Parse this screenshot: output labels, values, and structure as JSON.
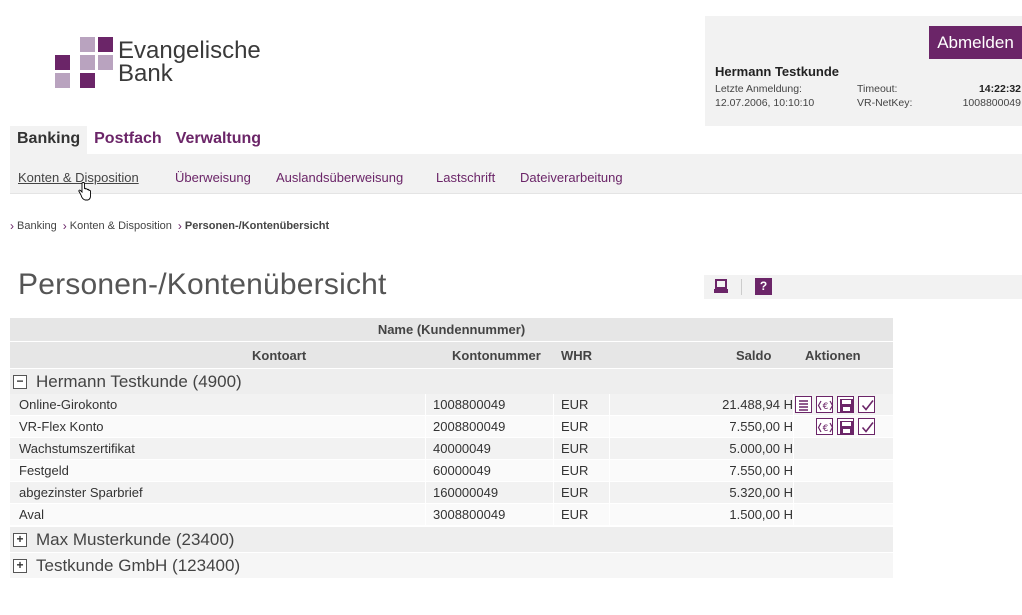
{
  "brand": {
    "name_line1": "Evangelische",
    "name_line2": "Bank",
    "colors": {
      "primary": "#6b2568",
      "light": "#b9a3bf"
    }
  },
  "user": {
    "logout_label": "Abmelden",
    "name": "Hermann Testkunde",
    "last_login_label": "Letzte Anmeldung:",
    "last_login_value": "12.07.2006, 10:10:10",
    "timeout_label": "Timeout:",
    "timeout_value": "14:22:32",
    "netkey_label": "VR-NetKey:",
    "netkey_value": "1008800049"
  },
  "topnav": [
    {
      "label": "Banking",
      "active": true
    },
    {
      "label": "Postfach",
      "active": false
    },
    {
      "label": "Verwaltung",
      "active": false
    }
  ],
  "subnav": [
    {
      "label": "Konten & Disposition",
      "active": true
    },
    {
      "label": "Überweisung",
      "active": false
    },
    {
      "label": "Auslandsüberweisung",
      "active": false
    },
    {
      "label": "Lastschrift",
      "active": false
    },
    {
      "label": "Dateiverarbeitung",
      "active": false
    }
  ],
  "breadcrumb": [
    "Banking",
    "Konten & Disposition",
    "Personen-/Kontenübersicht"
  ],
  "page_title": "Personen-/Kontenübersicht",
  "toolbar": {
    "print_icon": "printer-icon",
    "help_label": "?"
  },
  "table": {
    "group_header": "Name (Kundennummer)",
    "columns": {
      "kontoart": "Kontoart",
      "kontonummer": "Kontonummer",
      "whr": "WHR",
      "saldo": "Saldo",
      "aktionen": "Aktionen"
    },
    "groups": [
      {
        "name": "Hermann Testkunde (4900)",
        "expanded": true,
        "toggle": "−",
        "rows": [
          {
            "kontoart": "Online-Girokonto",
            "kontonummer": "1008800049",
            "whr": "EUR",
            "saldo": "21.488,94 H",
            "actions": [
              "list-icon",
              "euro-exchange-icon",
              "save-icon",
              "check-icon"
            ]
          },
          {
            "kontoart": "VR-Flex Konto",
            "kontonummer": "2008800049",
            "whr": "EUR",
            "saldo": "7.550,00 H",
            "actions": [
              "euro-exchange-icon",
              "save-icon",
              "check-icon"
            ]
          },
          {
            "kontoart": "Wachstumszertifikat",
            "kontonummer": "40000049",
            "whr": "EUR",
            "saldo": "5.000,00 H",
            "actions": []
          },
          {
            "kontoart": "Festgeld",
            "kontonummer": "60000049",
            "whr": "EUR",
            "saldo": "7.550,00 H",
            "actions": []
          },
          {
            "kontoart": "abgezinster Sparbrief",
            "kontonummer": "160000049",
            "whr": "EUR",
            "saldo": "5.320,00 H",
            "actions": []
          },
          {
            "kontoart": "Aval",
            "kontonummer": "3008800049",
            "whr": "EUR",
            "saldo": "1.500,00 H",
            "actions": []
          }
        ]
      },
      {
        "name": "Max Musterkunde (23400)",
        "expanded": false,
        "toggle": "+",
        "rows": []
      },
      {
        "name": "Testkunde GmbH (123400)",
        "expanded": false,
        "toggle": "+",
        "rows": []
      }
    ]
  }
}
